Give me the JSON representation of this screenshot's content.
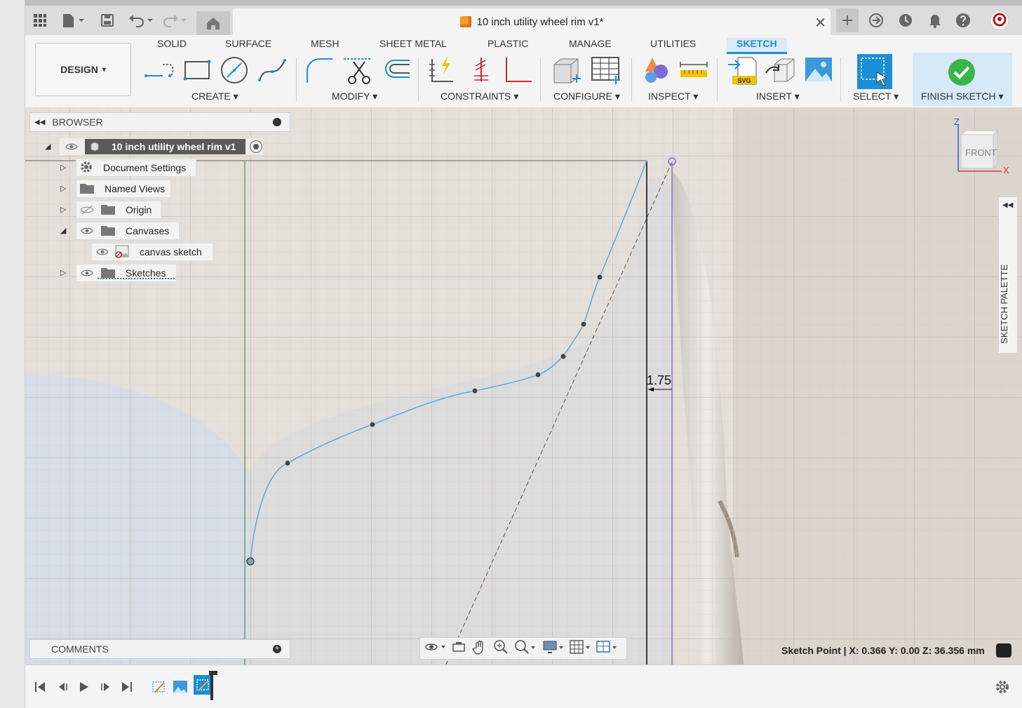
{
  "window": {
    "doc_title": "10 inch utility wheel rim v1*"
  },
  "toolbar": {
    "workspace": "DESIGN",
    "tabs": [
      {
        "label": "SOLID"
      },
      {
        "label": "SURFACE"
      },
      {
        "label": "MESH"
      },
      {
        "label": "SHEET METAL"
      },
      {
        "label": "PLASTIC"
      },
      {
        "label": "MANAGE"
      },
      {
        "label": "UTILITIES"
      },
      {
        "label": "SKETCH"
      }
    ],
    "active_tab": "SKETCH",
    "groups": [
      {
        "label": "CREATE"
      },
      {
        "label": "MODIFY"
      },
      {
        "label": "CONSTRAINTS"
      },
      {
        "label": "CONFIGURE"
      },
      {
        "label": "INSPECT"
      },
      {
        "label": "INSERT"
      },
      {
        "label": "SELECT"
      },
      {
        "label": "FINISH SKETCH"
      }
    ],
    "dropdown_glyph": "▾"
  },
  "browser": {
    "title": "BROWSER",
    "root": "10 inch utility wheel rim v1",
    "items": [
      {
        "label": "Document Settings"
      },
      {
        "label": "Named Views"
      },
      {
        "label": "Origin"
      },
      {
        "label": "Canvases"
      },
      {
        "label": "canvas sketch"
      },
      {
        "label": "Sketches"
      }
    ]
  },
  "comments": {
    "title": "COMMENTS"
  },
  "sketch": {
    "dimension": "1.75"
  },
  "viewcube": {
    "face": "FRONT",
    "z": "Z",
    "x": "X"
  },
  "palette": {
    "label": "SKETCH PALETTE"
  },
  "status": {
    "text": "Sketch Point | X: 0.366 Y: 0.00 Z: 36.356 mm"
  },
  "colors": {
    "accent": "#1a8fd6",
    "finish_green": "#3bb54a",
    "spline": "#5aaee0"
  }
}
